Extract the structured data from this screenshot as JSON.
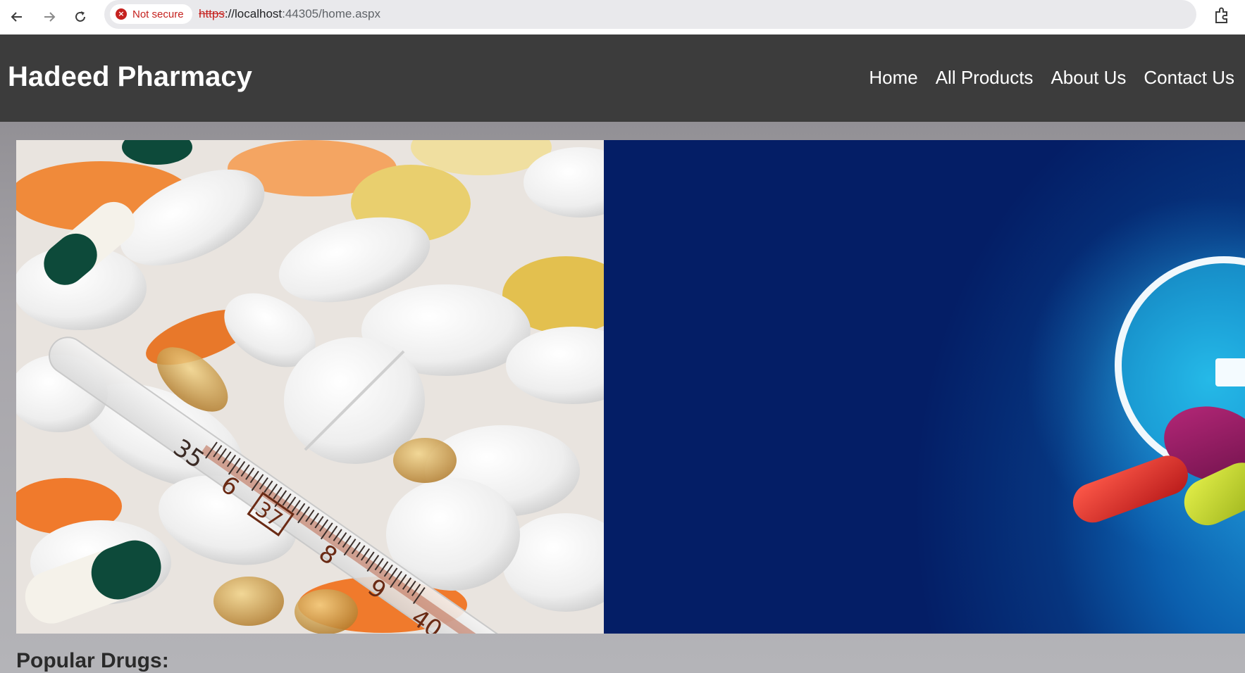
{
  "browser": {
    "security_label": "Not secure",
    "url_scheme": "https",
    "url_host": "://localhost",
    "url_rest": ":44305/home.aspx",
    "icons": [
      "back-arrow-icon",
      "forward-arrow-icon",
      "reload-icon",
      "not-secure-icon",
      "bookmark-star-icon",
      "extensions-icon"
    ]
  },
  "site": {
    "brand": "Hadeed Pharmacy",
    "nav": [
      {
        "label": "Home"
      },
      {
        "label": "All Products"
      },
      {
        "label": "About Us"
      },
      {
        "label": "Contact Us"
      }
    ]
  },
  "hero": {
    "thermometer_marks": [
      "35",
      "6",
      "37",
      "8",
      "9",
      "40"
    ]
  },
  "sections": {
    "popular_title": "Popular Drugs:"
  },
  "colors": {
    "header_bg": "#3c3c3c",
    "content_bg": "#b3b3b8",
    "insecure_red": "#c5221f",
    "hero_blue": "#041e66"
  }
}
